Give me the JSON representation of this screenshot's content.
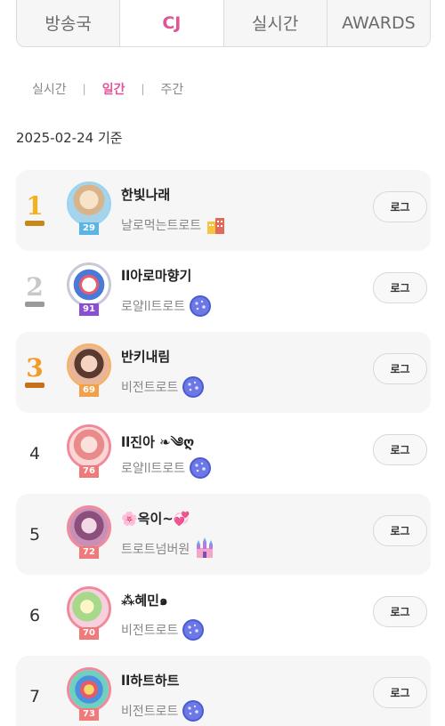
{
  "tabs": [
    {
      "label": "방송국",
      "active": false
    },
    {
      "label": "CJ",
      "active": true
    },
    {
      "label": "실시간",
      "active": false
    },
    {
      "label": "AWARDS",
      "active": false
    }
  ],
  "subtabs": [
    {
      "label": "실시간",
      "active": false
    },
    {
      "label": "일간",
      "active": true
    },
    {
      "label": "주간",
      "active": false
    }
  ],
  "date_label": "2025-02-24 기준",
  "log_label": "로그",
  "colors": {
    "accent": "#e0559a"
  },
  "rankings": [
    {
      "rank": "1",
      "name": "한빛나래",
      "group": "날로먹는트로트",
      "level": "29",
      "badge": "building-icon"
    },
    {
      "rank": "2",
      "name": "ll아로마향기",
      "group": "로얄ll트로트",
      "level": "91",
      "badge": "moon-icon"
    },
    {
      "rank": "3",
      "name": "반키내림",
      "group": "비전트로트",
      "level": "69",
      "badge": "moon-icon"
    },
    {
      "rank": "4",
      "name": "ll진아 ❧༄ღ",
      "group": "로얄ll트로트",
      "level": "76",
      "badge": "moon-icon"
    },
    {
      "rank": "5",
      "name": "🌸옥이~💞",
      "group": "트로트넘버원",
      "level": "72",
      "badge": "castle-icon"
    },
    {
      "rank": "6",
      "name": "⁂혜민๑",
      "group": "비전트로트",
      "level": "70",
      "badge": "moon-icon"
    },
    {
      "rank": "7",
      "name": "ll하트하트",
      "group": "비전트로트",
      "level": "73",
      "badge": "moon-icon"
    }
  ]
}
